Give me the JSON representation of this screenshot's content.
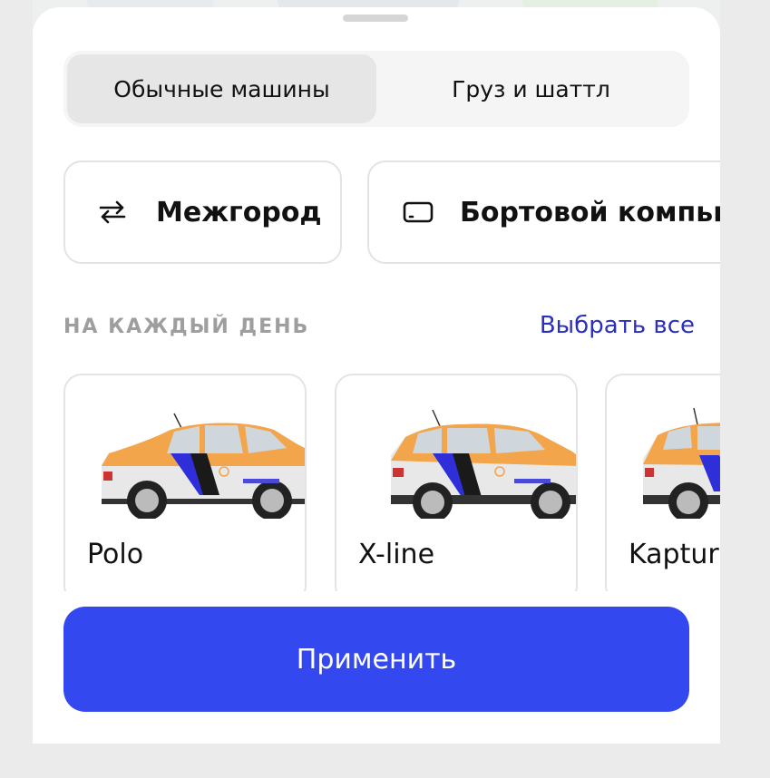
{
  "segments": [
    {
      "label": "Обычные машины",
      "active": true
    },
    {
      "label": "Груз и шаттл",
      "active": false
    }
  ],
  "chips": [
    {
      "label": "Межгород",
      "icon": "swap-arrows-icon"
    },
    {
      "label": "Бортовой компью",
      "icon": "tablet-icon"
    }
  ],
  "section": {
    "title": "НА КАЖДЫЙ ДЕНЬ",
    "select_all": "Выбрать все"
  },
  "cars": [
    {
      "name": "Polo"
    },
    {
      "name": "X-line"
    },
    {
      "name": "Kaptur"
    }
  ],
  "apply_label": "Применить",
  "colors": {
    "accent": "#3348ef",
    "link": "#2b2fbf",
    "car_orange": "#f2a54a",
    "car_blue": "#2f2fd9"
  }
}
